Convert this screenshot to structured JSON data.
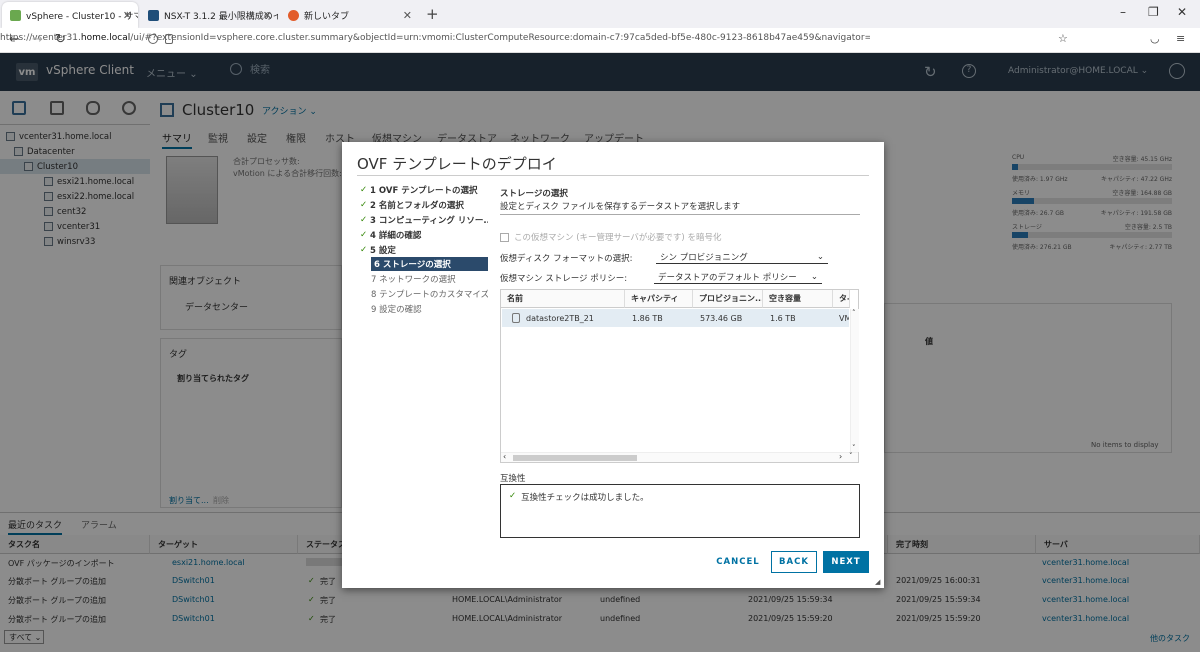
{
  "browser": {
    "tabs": [
      {
        "label": "vSphere - Cluster10 - サマリ",
        "favicon_color": "#6aa84f",
        "active": true
      },
      {
        "label": "NSX-T 3.1.2 最小限構成のインストー",
        "favicon_color": "#1f4e79",
        "active": false
      },
      {
        "label": "新しいタブ",
        "favicon_color": "#e25c2a",
        "active": false
      }
    ],
    "url_prefix": "https://vcenter31.",
    "url_host": "home.local",
    "url_rest": "/ui/#?extensionId=vsphere.core.cluster.summary&objectId=urn:vmomi:ClusterComputeResource:domain-c7:97ca5ded-bf5e-480c-9123-8618b47ae459&navigator=vsphere.core.viTree.hostsAndClustersV"
  },
  "vsphere": {
    "logo": "vm",
    "title": "vSphere Client",
    "menu": "メニュー",
    "search_placeholder": "検索",
    "user": "Administrator@HOME.LOCAL"
  },
  "tree": [
    {
      "label": "vcenter31.home.local",
      "indent": 0
    },
    {
      "label": "Datacenter",
      "indent": 1
    },
    {
      "label": "Cluster10",
      "indent": 2,
      "selected": true
    },
    {
      "label": "esxi21.home.local",
      "indent": 3
    },
    {
      "label": "esxi22.home.local",
      "indent": 3
    },
    {
      "label": "cent32",
      "indent": 3
    },
    {
      "label": "vcenter31",
      "indent": 3
    },
    {
      "label": "winsrv33",
      "indent": 3
    }
  ],
  "main": {
    "object_title": "Cluster10",
    "actions": "アクション",
    "tabs": [
      "サマリ",
      "監視",
      "設定",
      "権限",
      "ホスト",
      "仮想マシン",
      "データストア",
      "ネットワーク",
      "アップデート"
    ],
    "cpu_label": "合計プロセッサ数:",
    "vmotion_label": "vMotion による合計移行回数:",
    "related_objects": "関連オブジェクト",
    "datacenter": "データセンター",
    "tags": "タグ",
    "assigned_tag": "割り当てられたタグ",
    "assign_link": "割り当て...",
    "remove_link": "削除",
    "no_items": "No items to display",
    "col_value": "値"
  },
  "resources": [
    {
      "name": "CPU",
      "free": "空き容量: 45.15 GHz",
      "used": "使用済み: 1.97 GHz",
      "capacity": "キャパシティ: 47.22 GHz",
      "fill": 0.04
    },
    {
      "name": "メモリ",
      "free": "空き容量: 164.88 GB",
      "used": "使用済み: 26.7 GB",
      "capacity": "キャパシティ: 191.58 GB",
      "fill": 0.14
    },
    {
      "name": "ストレージ",
      "free": "空き容量: 2.5 TB",
      "used": "使用済み: 276.21 GB",
      "capacity": "キャパシティ: 2.77 TB",
      "fill": 0.1
    }
  ],
  "tasks": {
    "tab_recent": "最近のタスク",
    "tab_alarms": "アラーム",
    "headers": [
      "タスク名",
      "ターゲット",
      "ステータス",
      "",
      "",
      "",
      "完了時刻",
      "サーバ"
    ],
    "rows": [
      {
        "name": "OVF パッケージのインポート",
        "target": "esxi21.home.local",
        "status": "",
        "initiator": "",
        "queued": "",
        "start": "",
        "done": "",
        "server": "vcenter31.home.local"
      },
      {
        "name": "分散ポート グループの追加",
        "target": "DSwitch01",
        "status": "完了",
        "initiator": "",
        "queued": "",
        "start": "",
        "done": "2021/09/25 16:00:31",
        "server": "vcenter31.home.local"
      },
      {
        "name": "分散ポート グループの追加",
        "target": "DSwitch01",
        "status": "完了",
        "initiator": "HOME.LOCAL\\Administrator",
        "queued": "undefined",
        "start": "2021/09/25 15:59:34",
        "done": "2021/09/25 15:59:34",
        "server": "vcenter31.home.local"
      },
      {
        "name": "分散ポート グループの追加",
        "target": "DSwitch01",
        "status": "完了",
        "initiator": "HOME.LOCAL\\Administrator",
        "queued": "undefined",
        "start": "2021/09/25 15:59:20",
        "done": "2021/09/25 15:59:20",
        "server": "vcenter31.home.local"
      }
    ],
    "filter": "すべて",
    "more_tasks": "他のタスク"
  },
  "modal": {
    "title": "OVF テンプレートのデプロイ",
    "steps": [
      {
        "label": "1 OVF テンプレートの選択",
        "state": "done"
      },
      {
        "label": "2 名前とフォルダの選択",
        "state": "done"
      },
      {
        "label": "3 コンピューティング リソー...",
        "state": "done"
      },
      {
        "label": "4 詳細の確認",
        "state": "done"
      },
      {
        "label": "5 設定",
        "state": "done"
      },
      {
        "label": "6 ストレージの選択",
        "state": "current"
      },
      {
        "label": "7 ネットワークの選択",
        "state": "todo"
      },
      {
        "label": "8 テンプレートのカスタマイズ",
        "state": "todo"
      },
      {
        "label": "9 設定の確認",
        "state": "todo"
      }
    ],
    "section_title": "ストレージの選択",
    "section_subtitle": "設定とディスク ファイルを保存するデータストアを選択します",
    "encrypt_label": "この仮想マシン (キー管理サーバが必要です) を暗号化",
    "disk_format_label": "仮想ディスク フォーマットの選択:",
    "disk_format_value": "シン プロビジョニング",
    "storage_policy_label": "仮想マシン ストレージ ポリシー:",
    "storage_policy_value": "データストアのデフォルト ポリシー",
    "grid_headers": [
      "名前",
      "キャパシティ",
      "プロビジョニン...",
      "空き容量",
      "タ-"
    ],
    "grid_rows": [
      [
        "datastore2TB_21",
        "1.86 TB",
        "573.46 GB",
        "1.6 TB",
        "VM"
      ]
    ],
    "compat_label": "互換性",
    "compat_message": "互換性チェックは成功しました。",
    "btn_cancel": "CANCEL",
    "btn_back": "BACK",
    "btn_next": "NEXT"
  }
}
